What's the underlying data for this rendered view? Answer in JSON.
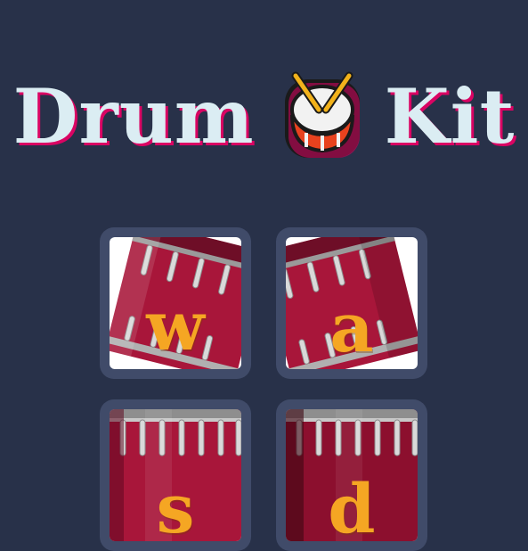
{
  "title": {
    "left_text": "Drum",
    "right_text": "Kit",
    "icon": "drum-icon"
  },
  "pads": [
    {
      "key": "w",
      "icon": "drum-tilted-icon"
    },
    {
      "key": "a",
      "icon": "drum-tilted-icon"
    },
    {
      "key": "s",
      "icon": "drum-upright-icon"
    },
    {
      "key": "d",
      "icon": "drum-upright-icon"
    }
  ],
  "colors": {
    "background": "#283149",
    "pad_background": "#404B69",
    "title_text": "#DBEDF3",
    "title_shadow": "#DA0463",
    "key_text": "#F5A623",
    "drum_red": "#A8163A"
  }
}
